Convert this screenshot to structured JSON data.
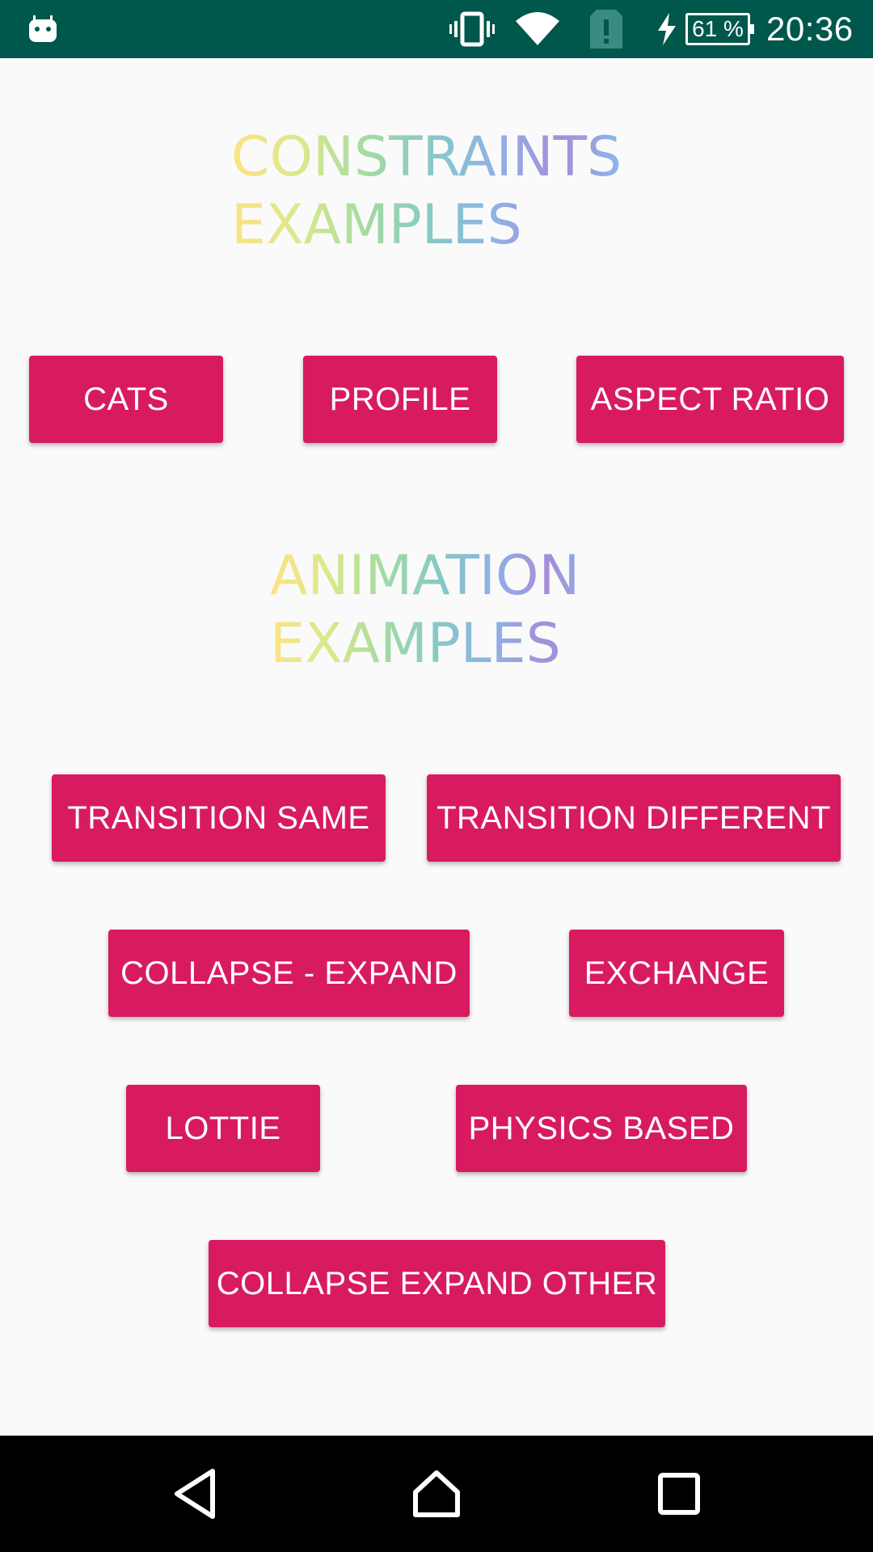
{
  "status_bar": {
    "time": "20:36",
    "battery": "61 %",
    "icons": [
      "android-icon",
      "vibrate-icon",
      "wifi-icon",
      "sim-alert-icon",
      "charging-icon",
      "battery-icon"
    ],
    "background": "#00574b"
  },
  "headings": {
    "constraints": "CONSTRAINTS\nEXAMPLES",
    "animation": "ANIMATION\nEXAMPLES"
  },
  "constraints_buttons": {
    "cats": "CATS",
    "profile": "PROFILE",
    "aspect_ratio": "ASPECT RATIO"
  },
  "animation_buttons": {
    "transition_same": "TRANSITION SAME",
    "transition_different": "TRANSITION DIFFERENT",
    "collapse_expand": "COLLAPSE - EXPAND",
    "exchange": "EXCHANGE",
    "lottie": "LOTTIE",
    "physics_based": "PHYSICS BASED",
    "collapse_expand_other": "COLLAPSE EXPAND OTHER"
  },
  "nav_bar": {
    "icons": [
      "back-icon",
      "home-icon",
      "recents-icon"
    ]
  },
  "colors": {
    "accent": "#d81b60",
    "page_background": "#fafafa",
    "gradient": [
      "#fde383",
      "#d9e88d",
      "#9fd9a5",
      "#86c9c6",
      "#8fb2e6",
      "#a48ed9",
      "#83c2ee"
    ]
  }
}
